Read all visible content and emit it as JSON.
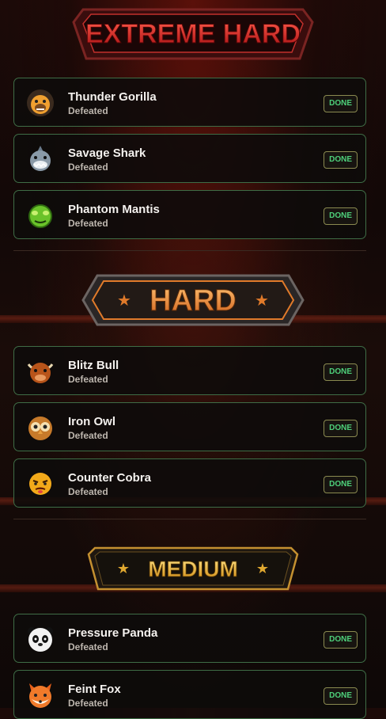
{
  "sections": [
    {
      "title": "EXTREME HARD",
      "opponents": [
        {
          "name": "Thunder Gorilla",
          "status": "Defeated",
          "badge": "DONE",
          "icon": "gorilla-icon"
        },
        {
          "name": "Savage Shark",
          "status": "Defeated",
          "badge": "DONE",
          "icon": "shark-icon"
        },
        {
          "name": "Phantom Mantis",
          "status": "Defeated",
          "badge": "DONE",
          "icon": "mantis-icon"
        }
      ]
    },
    {
      "title": "HARD",
      "opponents": [
        {
          "name": "Blitz Bull",
          "status": "Defeated",
          "badge": "DONE",
          "icon": "bull-icon"
        },
        {
          "name": "Iron Owl",
          "status": "Defeated",
          "badge": "DONE",
          "icon": "owl-icon"
        },
        {
          "name": "Counter Cobra",
          "status": "Defeated",
          "badge": "DONE",
          "icon": "cobra-icon"
        }
      ]
    },
    {
      "title": "MEDIUM",
      "opponents": [
        {
          "name": "Pressure Panda",
          "status": "Defeated",
          "badge": "DONE",
          "icon": "panda-icon"
        },
        {
          "name": "Feint Fox",
          "status": "Defeated",
          "badge": "DONE",
          "icon": "fox-icon"
        }
      ]
    }
  ],
  "colors": {
    "done_text": "#4ed07a",
    "card_border": "#3f6d46",
    "extreme": "#e0242a",
    "hard": "#f09a3a",
    "medium": "#f5c536"
  }
}
